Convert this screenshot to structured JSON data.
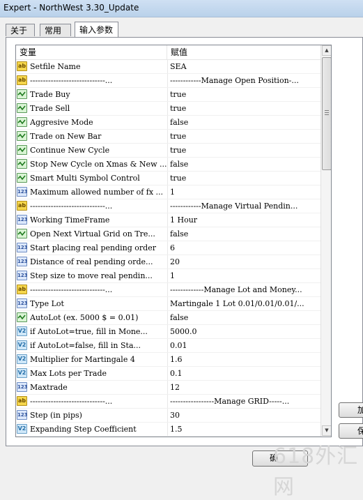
{
  "window": {
    "title": "Expert - NorthWest 3.30_Update"
  },
  "tabs": [
    {
      "label": "关于"
    },
    {
      "label": "常用"
    },
    {
      "label": "输入参数"
    }
  ],
  "grid": {
    "headers": {
      "variable": "变量",
      "value": "赋值"
    },
    "rows": [
      {
        "type": "ab",
        "icon_label": "ab",
        "name": "Setfile Name",
        "value": "SEA"
      },
      {
        "type": "ab",
        "icon_label": "ab",
        "name": "-----------------------------...",
        "value": "------------Manage Open Position-..."
      },
      {
        "type": "bool",
        "icon_label": "",
        "name": "Trade Buy",
        "value": "true"
      },
      {
        "type": "bool",
        "icon_label": "",
        "name": "Trade Sell",
        "value": "true"
      },
      {
        "type": "bool",
        "icon_label": "",
        "name": "Aggresive Mode",
        "value": "false"
      },
      {
        "type": "bool",
        "icon_label": "",
        "name": "Trade on New Bar",
        "value": "true"
      },
      {
        "type": "bool",
        "icon_label": "",
        "name": "Continue New Cycle",
        "value": "true"
      },
      {
        "type": "bool",
        "icon_label": "",
        "name": "Stop New Cycle on Xmas & New ...",
        "value": "false"
      },
      {
        "type": "bool",
        "icon_label": "",
        "name": "Smart Multi Symbol Control",
        "value": "true"
      },
      {
        "type": "int",
        "icon_label": "123",
        "name": "Maximum allowed number of fx ...",
        "value": "1"
      },
      {
        "type": "ab",
        "icon_label": "ab",
        "name": "-----------------------------...",
        "value": "------------Manage Virtual Pendin..."
      },
      {
        "type": "int",
        "icon_label": "123",
        "name": "Working TimeFrame",
        "value": "1 Hour"
      },
      {
        "type": "bool",
        "icon_label": "",
        "name": "Open Next Virtual Grid on Tre...",
        "value": "false"
      },
      {
        "type": "int",
        "icon_label": "123",
        "name": "Start placing real pending order",
        "value": "6"
      },
      {
        "type": "int",
        "icon_label": "123",
        "name": "Distance of real pending orde...",
        "value": "20"
      },
      {
        "type": "int",
        "icon_label": "123",
        "name": "Step size to move real pendin...",
        "value": "1"
      },
      {
        "type": "ab",
        "icon_label": "ab",
        "name": "-----------------------------...",
        "value": "-------------Manage Lot and Money..."
      },
      {
        "type": "int",
        "icon_label": "123",
        "name": "Type Lot",
        "value": "Martingale 1 Lot 0.01/0.01/0.01/..."
      },
      {
        "type": "bool",
        "icon_label": "",
        "name": "AutoLot (ex. 5000 $ = 0.01)",
        "value": "false"
      },
      {
        "type": "dbl",
        "icon_label": "V2",
        "name": "if AutoLot=true, fill in Mone...",
        "value": "5000.0"
      },
      {
        "type": "dbl",
        "icon_label": "V2",
        "name": "if AutoLot=false, fill in Sta...",
        "value": "0.01"
      },
      {
        "type": "dbl",
        "icon_label": "V2",
        "name": "Multiplier for Martingale 4",
        "value": "1.6"
      },
      {
        "type": "dbl",
        "icon_label": "V2",
        "name": "Max Lots per Trade",
        "value": "0.1"
      },
      {
        "type": "int",
        "icon_label": "123",
        "name": "Maxtrade",
        "value": "12"
      },
      {
        "type": "ab",
        "icon_label": "ab",
        "name": "-----------------------------...",
        "value": "-----------------Manage GRID-----..."
      },
      {
        "type": "int",
        "icon_label": "123",
        "name": "Step (in pips)",
        "value": "30"
      },
      {
        "type": "dbl",
        "icon_label": "V2",
        "name": "Expanding Step Coefficient",
        "value": "1.5"
      }
    ]
  },
  "side_buttons": [
    {
      "label": "加"
    },
    {
      "label": "保"
    }
  ],
  "ok_button": {
    "label": "确"
  },
  "watermark": {
    "text": "618外汇网"
  }
}
